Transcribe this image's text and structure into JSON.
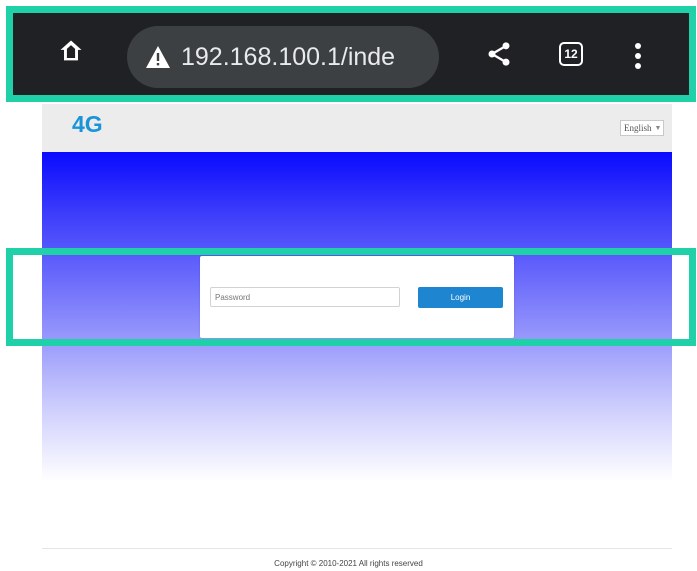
{
  "browser": {
    "url": "192.168.100.1/inde",
    "tab_count": "12",
    "icons": {
      "home": "home-icon",
      "warning": "not-secure-warning-icon",
      "share": "share-icon",
      "tabs": "tab-switcher-icon",
      "menu": "more-vert-icon"
    }
  },
  "router": {
    "logo": "4G",
    "language": "English"
  },
  "login": {
    "password_placeholder": "Password",
    "button_label": "Login"
  },
  "footer": {
    "copyright": "Copyright © 2010-2021 All rights reserved"
  },
  "colors": {
    "browser_bar": "#202124",
    "omnibox": "#3c4043",
    "logo": "#1a94d8",
    "gradient_top": "#0a0aff",
    "login_button": "#1e86d1",
    "highlight": "#1fd0a8"
  }
}
